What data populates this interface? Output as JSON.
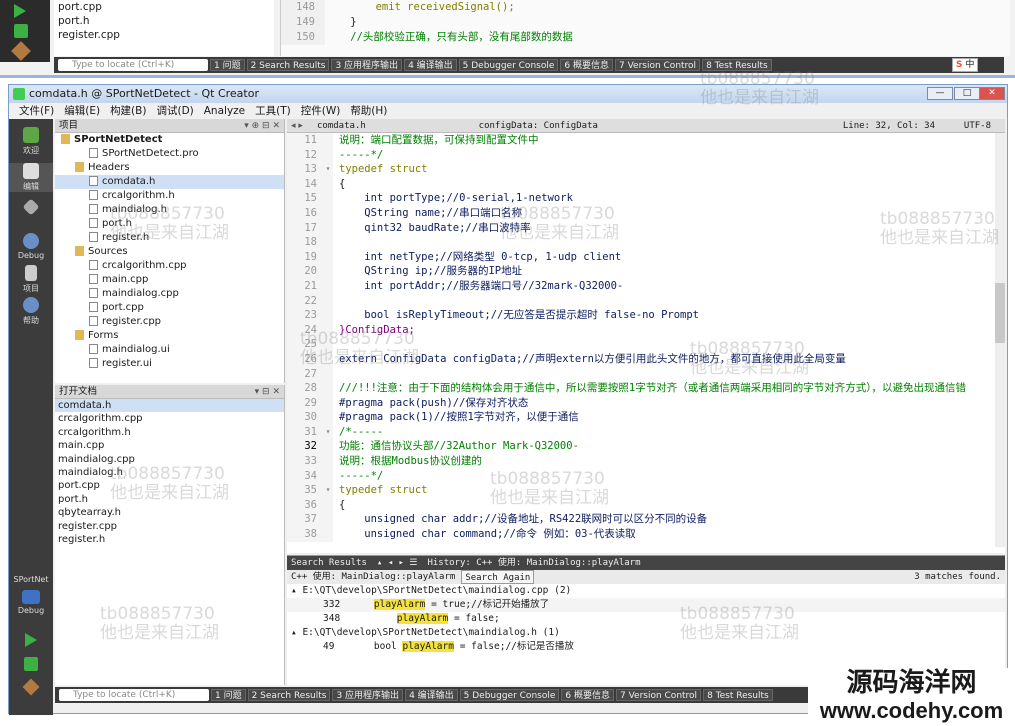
{
  "prev_window": {
    "files": [
      "port.cpp",
      "port.h",
      "register.cpp"
    ],
    "code": [
      {
        "n": "148",
        "t": "        emit receivedSignal();"
      },
      {
        "n": "149",
        "t": "    }"
      },
      {
        "n": "150",
        "t": "    //头部校验正确，只有头部，没有尾部数的数据"
      }
    ],
    "locator": "Type to locate (Ctrl+K)",
    "tabs": [
      "1 问题",
      "2 Search Results",
      "3 应用程序输出",
      "4 编译输出",
      "5 Debugger Console",
      "6 概要信息",
      "7 Version Control",
      "8 Test Results"
    ],
    "tray": "中"
  },
  "window": {
    "title": "comdata.h @ SPortNetDetect - Qt Creator",
    "controls": [
      "—",
      "□",
      "✕"
    ]
  },
  "menu": [
    "文件(F)",
    "编辑(E)",
    "构建(B)",
    "调试(D)",
    "Analyze",
    "工具(T)",
    "控件(W)",
    "帮助(H)"
  ],
  "modes": [
    "欢迎",
    "编辑",
    "",
    "Debug",
    "项目",
    "帮助"
  ],
  "project_pane": {
    "header": "项目"
  },
  "tree": [
    {
      "label": "SPortNetDetect",
      "indent": 0,
      "bold": true
    },
    {
      "label": "SPortNetDetect.pro",
      "indent": 2
    },
    {
      "label": "Headers",
      "indent": 1
    },
    {
      "label": "comdata.h",
      "indent": 2
    },
    {
      "label": "crcalgorithm.h",
      "indent": 2
    },
    {
      "label": "maindialog.h",
      "indent": 2
    },
    {
      "label": "port.h",
      "indent": 2
    },
    {
      "label": "register.h",
      "indent": 2
    },
    {
      "label": "Sources",
      "indent": 1
    },
    {
      "label": "crcalgorithm.cpp",
      "indent": 2
    },
    {
      "label": "main.cpp",
      "indent": 2
    },
    {
      "label": "maindialog.cpp",
      "indent": 2
    },
    {
      "label": "port.cpp",
      "indent": 2
    },
    {
      "label": "register.cpp",
      "indent": 2
    },
    {
      "label": "Forms",
      "indent": 1
    },
    {
      "label": "maindialog.ui",
      "indent": 2
    },
    {
      "label": "register.ui",
      "indent": 2
    }
  ],
  "open_docs": {
    "header": "打开文档",
    "items": [
      "comdata.h",
      "crcalgorithm.cpp",
      "crcalgorithm.h",
      "main.cpp",
      "maindialog.cpp",
      "maindialog.h",
      "port.cpp",
      "port.h",
      "qbytearray.h",
      "register.cpp",
      "register.h"
    ]
  },
  "editor": {
    "file_tab": "comdata.h",
    "symbol": "configData: ConfigData",
    "position": "Line: 32, Col: 34",
    "encoding": "UTF-8"
  },
  "code": [
    {
      "n": "11",
      "f": "",
      "t": "说明：端口配置数据，可保持到配置文件中",
      "c": "cm"
    },
    {
      "n": "12",
      "f": "",
      "t": "-----*/",
      "c": "cm"
    },
    {
      "n": "13",
      "f": "▾",
      "t": "typedef struct",
      "c": "kw"
    },
    {
      "n": "14",
      "f": "",
      "t": "{",
      "c": ""
    },
    {
      "n": "15",
      "f": "",
      "t": "    int portType;//0-serial,1-network",
      "c": "mix"
    },
    {
      "n": "16",
      "f": "",
      "t": "    QString name;//串口端口名称",
      "c": "mix"
    },
    {
      "n": "17",
      "f": "",
      "t": "    qint32 baudRate;//串口波特率",
      "c": "mix"
    },
    {
      "n": "18",
      "f": "",
      "t": "",
      "c": ""
    },
    {
      "n": "19",
      "f": "",
      "t": "    int netType;//网络类型 0-tcp, 1-udp client",
      "c": "mix"
    },
    {
      "n": "20",
      "f": "",
      "t": "    QString ip;//服务器的IP地址",
      "c": "mix"
    },
    {
      "n": "21",
      "f": "",
      "t": "    int portAddr;//服务器端口号//32mark-Q32000-",
      "c": "mix"
    },
    {
      "n": "22",
      "f": "",
      "t": "",
      "c": ""
    },
    {
      "n": "23",
      "f": "",
      "t": "    bool isReplyTimeout;//无应答是否提示超时 false-no Prompt",
      "c": "mix"
    },
    {
      "n": "24",
      "f": "",
      "t": "}ConfigData;",
      "c": "ty"
    },
    {
      "n": "25",
      "f": "",
      "t": "",
      "c": ""
    },
    {
      "n": "26",
      "f": "",
      "t": "extern ConfigData configData;//声明extern以方便引用此头文件的地方，都可直接使用此全局变量",
      "c": "mix"
    },
    {
      "n": "27",
      "f": "",
      "t": "",
      "c": ""
    },
    {
      "n": "28",
      "f": "",
      "t": "///!!!注意：由于下面的结构体会用于通信中，所以需要按照1字节对齐（或者通信两端采用相同的字节对齐方式），以避免出现通信错",
      "c": "cm"
    },
    {
      "n": "29",
      "f": "",
      "t": "#pragma pack(push)//保存对齐状态",
      "c": "mix"
    },
    {
      "n": "30",
      "f": "",
      "t": "#pragma pack(1)//按照1字节对齐，以便于通信",
      "c": "mix"
    },
    {
      "n": "31",
      "f": "▾",
      "t": "/*-----",
      "c": "cm"
    },
    {
      "n": "32",
      "f": "",
      "t": "功能：通信协议头部//32Author Mark-Q32000-",
      "c": "cm"
    },
    {
      "n": "33",
      "f": "",
      "t": "说明：根据Modbus协议创建的",
      "c": "cm"
    },
    {
      "n": "34",
      "f": "",
      "t": "-----*/",
      "c": "cm"
    },
    {
      "n": "35",
      "f": "▾",
      "t": "typedef struct",
      "c": "kw"
    },
    {
      "n": "36",
      "f": "",
      "t": "{",
      "c": ""
    },
    {
      "n": "37",
      "f": "",
      "t": "    unsigned char addr;//设备地址，RS422联网时可以区分不同的设备",
      "c": "mix"
    },
    {
      "n": "38",
      "f": "",
      "t": "    unsigned char command;//命令 例如：03-代表读取",
      "c": "mix"
    }
  ],
  "search": {
    "title": "Search Results",
    "history": "History: C++ 使用: MainDialog::playAlarm",
    "query": "C++ 使用: MainDialog::playAlarm",
    "again": "Search Again",
    "matches": "3 matches found.",
    "results": [
      {
        "type": "file",
        "text": "E:\\QT\\develop\\SPortNetDetect\\maindialog.cpp (2)"
      },
      {
        "type": "line",
        "n": "332",
        "pre": "    ",
        "hl": "playAlarm",
        "post": " = true;//标记开始播放了"
      },
      {
        "type": "line",
        "n": "348",
        "pre": "        ",
        "hl": "playAlarm",
        "post": " = false;"
      },
      {
        "type": "file",
        "text": "E:\\QT\\develop\\SPortNetDetect\\maindialog.h (1)"
      },
      {
        "type": "line",
        "n": "49",
        "pre": "    bool ",
        "hl": "playAlarm",
        "post": " = false;//标记是否播放"
      }
    ]
  },
  "session": {
    "project": "SPortNet",
    "mode": "Debug"
  },
  "watermark": {
    "id": "tb088857730",
    "text": "他也是来自江湖"
  },
  "brand": {
    "cn": "源码海洋网",
    "url": "www.codehy.com"
  },
  "colors": {
    "highlight": "#f5e33a",
    "sidebar": "#3c3c3c",
    "titlebar": "#c3d6ee"
  }
}
